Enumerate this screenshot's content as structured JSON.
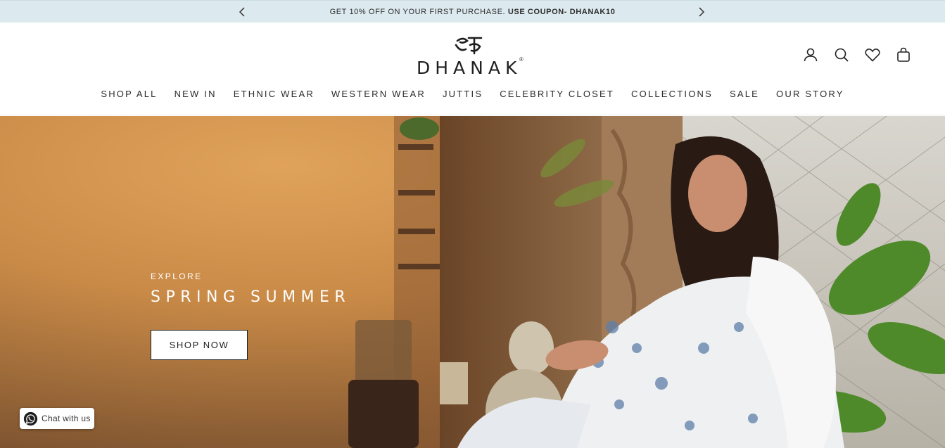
{
  "announcement": {
    "text": "GET 10% OFF ON YOUR FIRST PURCHASE.",
    "coupon": "USE COUPON- DHANAK10"
  },
  "brand": {
    "name": "DHANAK",
    "registered": "®"
  },
  "header_icons": [
    "account-icon",
    "search-icon",
    "wishlist-heart-icon",
    "cart-bag-icon"
  ],
  "nav": {
    "items": [
      {
        "label": "SHOP ALL"
      },
      {
        "label": "NEW IN"
      },
      {
        "label": "ETHNIC WEAR"
      },
      {
        "label": "WESTERN WEAR"
      },
      {
        "label": "JUTTIS"
      },
      {
        "label": "CELEBRITY CLOSET"
      },
      {
        "label": "COLLECTIONS"
      },
      {
        "label": "SALE"
      },
      {
        "label": "OUR STORY"
      }
    ]
  },
  "hero": {
    "eyebrow": "EXPLORE",
    "headline": "SPRING SUMMER",
    "cta": "SHOP NOW"
  },
  "chat": {
    "label": "Chat with us"
  },
  "colors": {
    "announcement_bg": "#dce9ee",
    "text": "#222222",
    "hero_warm": "#c98a47"
  }
}
